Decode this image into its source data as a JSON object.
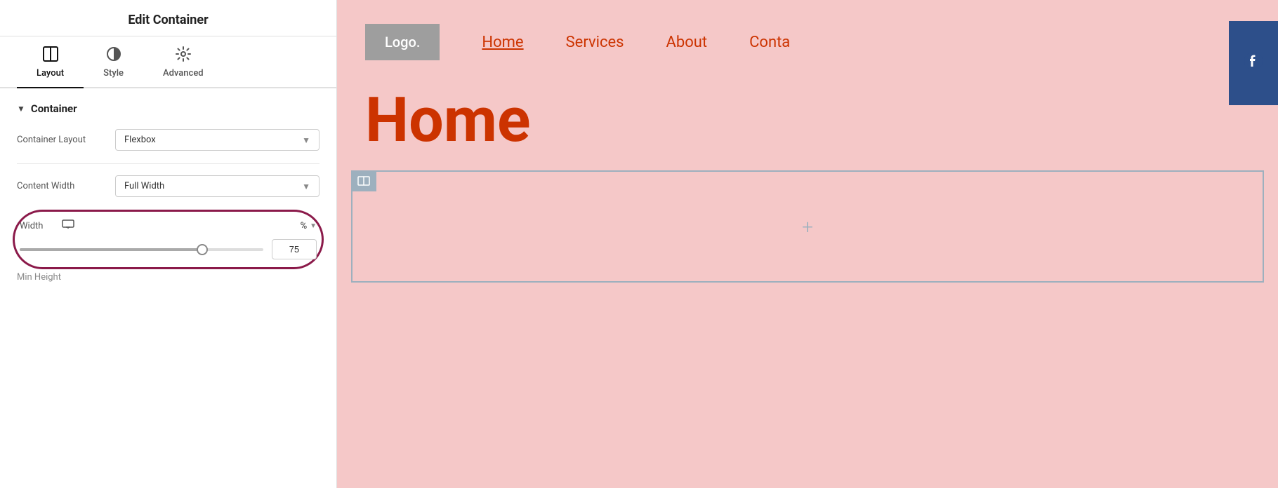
{
  "panel": {
    "title": "Edit Container",
    "tabs": [
      {
        "id": "layout",
        "label": "Layout",
        "icon": "layout",
        "active": true
      },
      {
        "id": "style",
        "label": "Style",
        "icon": "style",
        "active": false
      },
      {
        "id": "advanced",
        "label": "Advanced",
        "icon": "advanced",
        "active": false
      }
    ],
    "section": {
      "label": "Container"
    },
    "fields": {
      "container_layout": {
        "label": "Container Layout",
        "value": "Flexbox"
      },
      "content_width": {
        "label": "Content Width",
        "value": "Full Width"
      },
      "width": {
        "label": "Width",
        "unit": "%",
        "value": "75"
      }
    }
  },
  "canvas": {
    "logo": "Logo.",
    "nav": {
      "links": [
        {
          "id": "home",
          "label": "Home",
          "active": true
        },
        {
          "id": "services",
          "label": "Services",
          "active": false
        },
        {
          "id": "about",
          "label": "About",
          "active": false
        },
        {
          "id": "contact",
          "label": "Conta",
          "active": false
        }
      ]
    },
    "hero_text": "Home",
    "facebook_icon": "f",
    "plus_icon": "+"
  }
}
